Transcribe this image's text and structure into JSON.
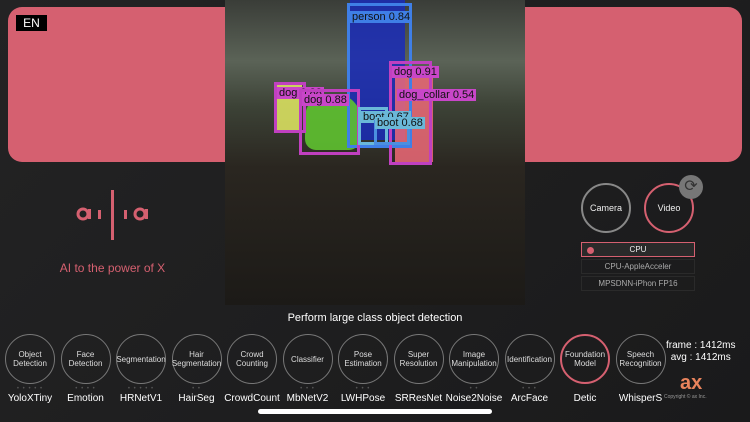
{
  "language": "EN",
  "tagline": "AI to the power of X",
  "logo_text": "ailia",
  "detections": [
    "person 0.84",
    "dog 0.91",
    "dog_collar 0.54",
    "dog 0.88",
    "dog 0.88",
    "boot 0.67",
    "boot 0.68"
  ],
  "modes": {
    "camera": "Camera",
    "video": "Video"
  },
  "devices": [
    "CPU",
    "CPU-AppleAcceler",
    "MPSDNN-iPhon FP16"
  ],
  "description": "Perform large class object detection",
  "models": [
    {
      "category": "Object Detection",
      "name": "YoloXTiny",
      "dots": "• • • • •"
    },
    {
      "category": "Face Detection",
      "name": "Emotion",
      "dots": "• • • •"
    },
    {
      "category": "Segmentation",
      "name": "HRNetV1",
      "dots": "• • • • •"
    },
    {
      "category": "Hair Segmentation",
      "name": "HairSeg",
      "dots": "• •"
    },
    {
      "category": "Crowd Counting",
      "name": "CrowdCount",
      "dots": ""
    },
    {
      "category": "Classifier",
      "name": "MbNetV2",
      "dots": "• • •"
    },
    {
      "category": "Pose Estimation",
      "name": "LWHPose",
      "dots": "• • •"
    },
    {
      "category": "Super Resolution",
      "name": "SRResNet",
      "dots": ""
    },
    {
      "category": "Image Manipulation",
      "name": "Noise2Noise",
      "dots": "• •"
    },
    {
      "category": "Identification",
      "name": "ArcFace",
      "dots": "• • •"
    },
    {
      "category": "Foundation Model",
      "name": "Detic",
      "dots": ""
    },
    {
      "category": "Speech Recognition",
      "name": "WhisperS",
      "dots": ""
    }
  ],
  "stats": {
    "frame": "frame : 1412ms",
    "avg": "avg : 1412ms"
  },
  "brand": "ax",
  "copyright": "Copyright © ax Inc.",
  "colors": {
    "accent": "#d56070"
  }
}
